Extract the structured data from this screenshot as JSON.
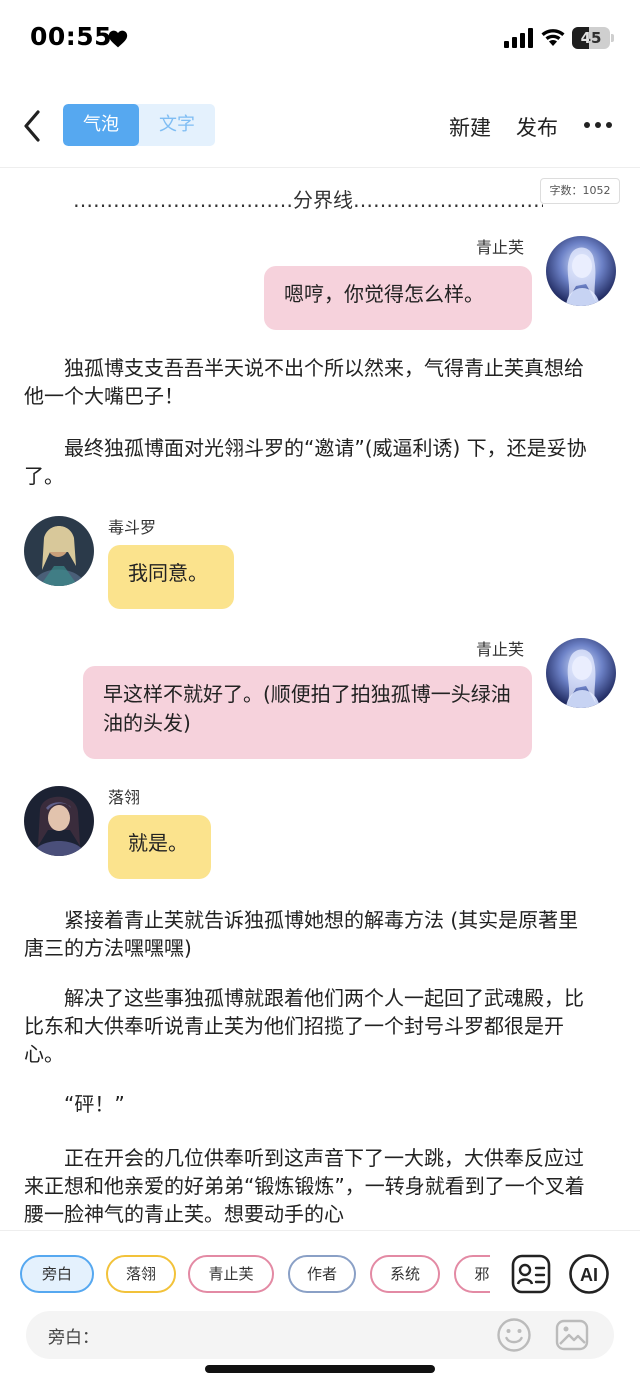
{
  "status_bar": {
    "time": "00:55",
    "battery_level": "45",
    "battery_fraction": 0.45
  },
  "nav": {
    "tabs": [
      {
        "label": "气泡",
        "active": true
      },
      {
        "label": "文字",
        "active": false
      }
    ],
    "new_label": "新建",
    "publish_label": "发布"
  },
  "content": {
    "divider": "……………………………分界线……………………………",
    "word_count": "字数：1052",
    "messages": [
      {
        "speaker": "青止芙",
        "text": "嗯哼，你觉得怎么样。",
        "side": "right",
        "color": "#f6d2dc"
      },
      {
        "speaker": "毒斗罗",
        "text": "我同意。",
        "side": "left",
        "color": "#fbe38d"
      },
      {
        "speaker": "青止芙",
        "text": "早这样不就好了。(顺便拍了拍独孤博一头绿油油的头发)",
        "side": "right",
        "color": "#f6d2dc"
      },
      {
        "speaker": "落翎",
        "text": "就是。",
        "side": "left",
        "color": "#fbe38d"
      }
    ],
    "paragraphs": [
      "独孤博支支吾吾半天说不出个所以然来，气得青止芙真想给他一个大嘴巴子！",
      "最终独孤博面对光翎斗罗的“邀请”(威逼利诱) 下，还是妥协了。",
      "紧接着青止芙就告诉独孤博她想的解毒方法 (其实是原著里唐三的方法嘿嘿嘿)",
      "解决了这些事独孤博就跟着他们两个人一起回了武魂殿，比比东和大供奉听说青止芙为他们招揽了一个封号斗罗都很是开心。",
      "“砰！”",
      "正在开会的几位供奉听到这声音下了一大跳，大供奉反应过来正想和他亲爱的好弟弟“锻炼锻炼”，一转身就看到了一个叉着腰一脸神气的青止芙。想要动手的心"
    ]
  },
  "bottom": {
    "roles": [
      "旁白",
      "落翎",
      "青止芙",
      "作者",
      "系统",
      "邪..."
    ],
    "input_label": "旁白：",
    "input_value": "",
    "ai_label": "AI"
  }
}
